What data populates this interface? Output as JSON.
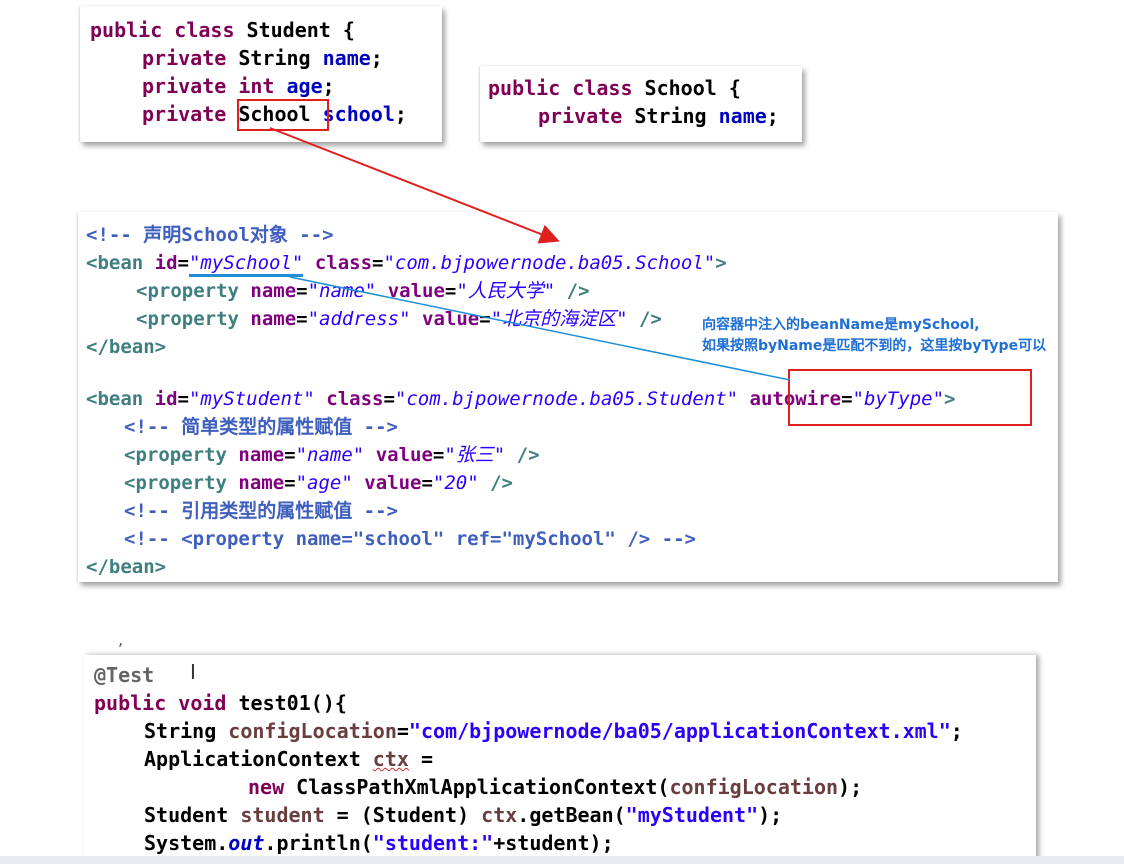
{
  "student_class": {
    "l1_kw": "public class ",
    "l1_name": "Student",
    "l1_end": " {",
    "l2_kw": "private ",
    "l2_type": "String ",
    "l2_field": "name",
    "l3_kw": "private int ",
    "l3_field": "age",
    "l4_kw": "private ",
    "l4_type": "School",
    "l4_field": "school"
  },
  "school_class": {
    "l1_kw": "public class ",
    "l1_name": "School",
    "l1_end": " {",
    "l2_kw": "private ",
    "l2_type": "String ",
    "l2_field": "name"
  },
  "xml": {
    "comment1": "<!-- 声明School对象 -->",
    "bean1_id": "\"mySchool\"",
    "bean1_class": "\"com.bjpowernode.ba05.School\"",
    "prop1_name": "\"name\"",
    "prop1_value": "\"人民大学\"",
    "prop2_name": "\"address\"",
    "prop2_value": "\"北京的海淀区\"",
    "bean_close": "</bean>",
    "bean2_id": "\"myStudent\"",
    "bean2_class": "\"com.bjpowernode.ba05.Student\"",
    "autowire_attr": "autowire",
    "autowire_value": "\"byType\"",
    "comment2": "<!-- 简单类型的属性赋值 -->",
    "prop3_name": "\"name\"",
    "prop3_value": "\"张三\"",
    "prop4_name": "\"age\"",
    "prop4_value": "\"20\"",
    "comment3": "<!-- 引用类型的属性赋值 -->",
    "comment4": "<!-- <property name=\"school\" ref=\"mySchool\" /> -->"
  },
  "annotation_note": {
    "line1": "向容器中注入的beanName是mySchool,",
    "line2": "如果按照byName是匹配不到的，这里按byType可以"
  },
  "test_code": {
    "annotation": "@Test",
    "sig": "public void test01(){",
    "l1_type": "String ",
    "l1_var": "configLocation",
    "l1_str": "\"com/bjpowernode/ba05/applicationContext.xml\"",
    "l2_type": "ApplicationContext ",
    "l2_var": "ctx",
    "l3_new": "new ",
    "l3_call": "ClassPathXmlApplicationContext(",
    "l3_arg": "configLocation",
    "l4_type": "Student ",
    "l4_var": "student",
    "l4_str": "\"myStudent\"",
    "l5_sys": "System.",
    "l5_out": "out",
    "l5_print": ".println(",
    "l5_str": "\"student:\"",
    "l5_tail": "+student);"
  },
  "colors": {
    "arrow_red": "#e0201e",
    "arrow_blue": "#1e8fd6"
  }
}
